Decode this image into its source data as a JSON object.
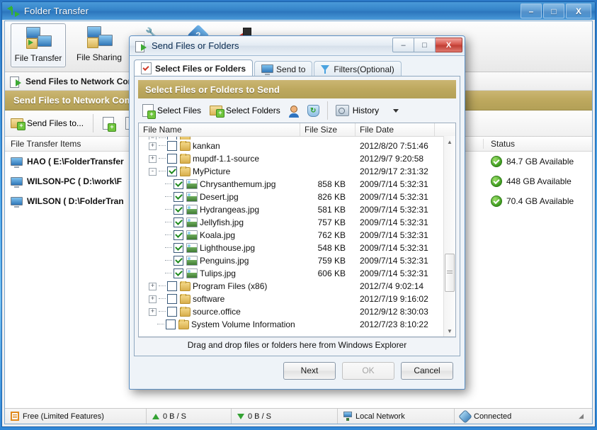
{
  "main_window": {
    "title": "Folder Transfer",
    "title_icon": "transfer-arrows-icon",
    "controls": {
      "minimize": "–",
      "maximize": "□",
      "close": "X"
    },
    "ribbon": [
      {
        "label": "File Transfer",
        "icon": "file-transfer-icon",
        "selected": true
      },
      {
        "label": "File Sharing",
        "icon": "file-sharing-icon",
        "selected": false
      }
    ],
    "ribbon_plain_icons": [
      "wrench-icon",
      "help-icon",
      "exit-icon"
    ],
    "section_header": "Send Files to Network Computers",
    "tan_bar": "Send Files to Network Computers",
    "toolbar": [
      {
        "label": "Send Files to...",
        "icon": "send-folder-icon"
      },
      {
        "label": "",
        "icon": "remove-file-icon"
      },
      {
        "label": "",
        "icon": "copy-file-icon"
      }
    ],
    "list": {
      "columns": [
        "File Transfer Items",
        "Status"
      ],
      "rows": [
        {
          "name": "HAO ( E:\\FolderTransfer",
          "status": "84.7 GB Available",
          "icon": "computer-icon",
          "status_icon": "green-check-icon"
        },
        {
          "name": "WILSON-PC ( D:\\work\\F",
          "status": "448 GB Available",
          "icon": "computer-icon",
          "status_icon": "green-check-icon"
        },
        {
          "name": "WILSON ( D:\\FolderTran",
          "status": "70.4 GB Available",
          "icon": "computer-icon",
          "status_icon": "green-check-icon"
        }
      ]
    },
    "statusbar": [
      {
        "label": "Free (Limited Features)",
        "icon": "license-icon"
      },
      {
        "label": "0 B / S",
        "icon": "upload-arrow-icon"
      },
      {
        "label": "0 B / S",
        "icon": "download-arrow-icon"
      },
      {
        "label": "Local Network",
        "icon": "network-icon"
      },
      {
        "label": "Connected",
        "icon": "plug-icon"
      }
    ]
  },
  "dialog": {
    "title": "Send Files or Folders",
    "title_icon": "send-files-icon",
    "controls": {
      "minimize": "–",
      "maximize": "□",
      "close": "X"
    },
    "tabs": [
      {
        "label": "Select Files or Folders",
        "icon": "checklist-icon",
        "active": true
      },
      {
        "label": "Send to",
        "icon": "monitor-icon",
        "active": false
      },
      {
        "label": "Filters(Optional)",
        "icon": "funnel-icon",
        "active": false
      }
    ],
    "tan_bar": "Select Files or Folders to Send",
    "toolbar": [
      {
        "label": "Select Files",
        "icon": "add-file-icon"
      },
      {
        "label": "Select Folders",
        "icon": "add-folder-icon"
      },
      {
        "label": "",
        "icon": "user-icon"
      },
      {
        "label": "",
        "icon": "refresh-shield-icon"
      },
      {
        "label": "History",
        "icon": "history-icon",
        "has_caret": true
      }
    ],
    "columns": [
      "File Name",
      "File Size",
      "File Date"
    ],
    "rows": [
      {
        "name": "kankan",
        "size": "",
        "date": "2012/8/20 7:51:46",
        "depth": 0,
        "expander": "+",
        "checked": false,
        "icon": "folder-icon"
      },
      {
        "name": "mupdf-1.1-source",
        "size": "",
        "date": "2012/9/7 9:20:58",
        "depth": 0,
        "expander": "+",
        "checked": false,
        "icon": "folder-icon"
      },
      {
        "name": "MyPicture",
        "size": "",
        "date": "2012/9/17 2:31:32",
        "depth": 0,
        "expander": "-",
        "checked": true,
        "icon": "folder-icon"
      },
      {
        "name": "Chrysanthemum.jpg",
        "size": "858 KB",
        "date": "2009/7/14 5:32:31",
        "depth": 1,
        "expander": "none",
        "checked": true,
        "icon": "image-icon"
      },
      {
        "name": "Desert.jpg",
        "size": "826 KB",
        "date": "2009/7/14 5:32:31",
        "depth": 1,
        "expander": "none",
        "checked": true,
        "icon": "image-icon"
      },
      {
        "name": "Hydrangeas.jpg",
        "size": "581 KB",
        "date": "2009/7/14 5:32:31",
        "depth": 1,
        "expander": "none",
        "checked": true,
        "icon": "image-icon"
      },
      {
        "name": "Jellyfish.jpg",
        "size": "757 KB",
        "date": "2009/7/14 5:32:31",
        "depth": 1,
        "expander": "none",
        "checked": true,
        "icon": "image-icon"
      },
      {
        "name": "Koala.jpg",
        "size": "762 KB",
        "date": "2009/7/14 5:32:31",
        "depth": 1,
        "expander": "none",
        "checked": true,
        "icon": "image-icon"
      },
      {
        "name": "Lighthouse.jpg",
        "size": "548 KB",
        "date": "2009/7/14 5:32:31",
        "depth": 1,
        "expander": "none",
        "checked": true,
        "icon": "image-icon"
      },
      {
        "name": "Penguins.jpg",
        "size": "759 KB",
        "date": "2009/7/14 5:32:31",
        "depth": 1,
        "expander": "none",
        "checked": true,
        "icon": "image-icon"
      },
      {
        "name": "Tulips.jpg",
        "size": "606 KB",
        "date": "2009/7/14 5:32:31",
        "depth": 1,
        "expander": "none",
        "checked": true,
        "icon": "image-icon"
      },
      {
        "name": "Program Files (x86)",
        "size": "",
        "date": "2012/7/4 9:02:14",
        "depth": 0,
        "expander": "+",
        "checked": false,
        "icon": "folder-icon"
      },
      {
        "name": "software",
        "size": "",
        "date": "2012/7/19 9:16:02",
        "depth": 0,
        "expander": "+",
        "checked": false,
        "icon": "folder-icon"
      },
      {
        "name": "source.office",
        "size": "",
        "date": "2012/9/12 8:30:03",
        "depth": 0,
        "expander": "+",
        "checked": false,
        "icon": "folder-icon"
      },
      {
        "name": "System Volume Information",
        "size": "",
        "date": "2012/7/23 8:10:22",
        "depth": 0,
        "expander": "none",
        "checked": false,
        "icon": "folder-icon"
      }
    ],
    "drop_hint": "Drag and drop files or folders here from Windows Explorer",
    "buttons": [
      {
        "label": "Next",
        "enabled": true
      },
      {
        "label": "OK",
        "enabled": false
      },
      {
        "label": "Cancel",
        "enabled": true
      }
    ]
  },
  "colors": {
    "accent_tan": "#bda85e",
    "title_blue": "#3483c8",
    "close_red": "#c03e34",
    "status_green": "#3f9c20"
  }
}
